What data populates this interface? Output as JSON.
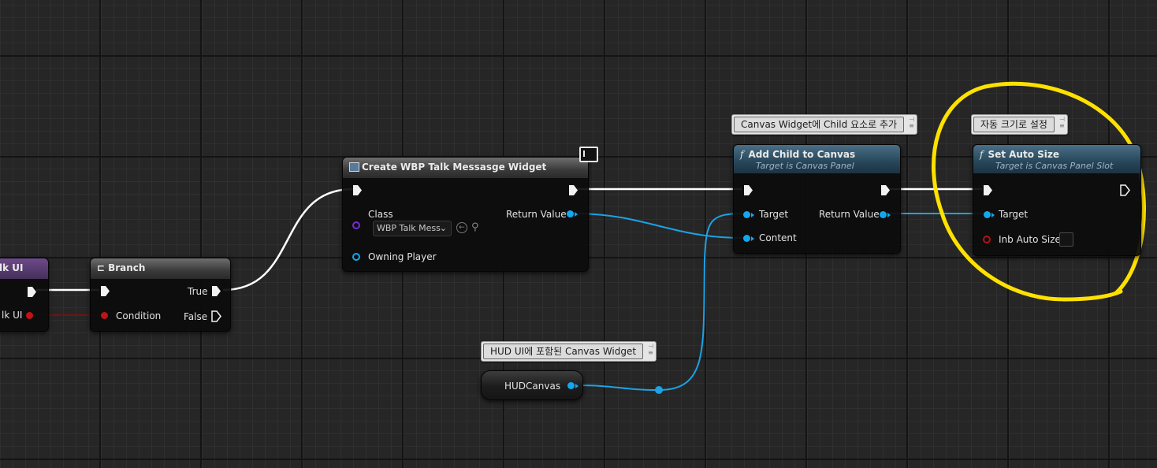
{
  "nodes": {
    "partial_event": {
      "title": "lk UI",
      "pin_label": "lk UI"
    },
    "branch": {
      "title": "Branch",
      "condition": "Condition",
      "true_label": "True",
      "false_label": "False"
    },
    "create_widget": {
      "title": "Create WBP Talk Messasge Widget",
      "class_label": "Class",
      "class_value": "WBP Talk Mess",
      "owning_player": "Owning Player",
      "return_value": "Return Value"
    },
    "add_child": {
      "title": "Add Child to Canvas",
      "subtitle": "Target is Canvas Panel",
      "target": "Target",
      "content": "Content",
      "return_value": "Return Value"
    },
    "set_auto_size": {
      "title": "Set Auto Size",
      "subtitle": "Target is Canvas Panel Slot",
      "target": "Target",
      "inb_auto_size": "Inb Auto Size",
      "inb_auto_size_checked": false
    },
    "hud_canvas": {
      "label": "HUDCanvas"
    }
  },
  "comments": {
    "add_child": "Canvas Widget에 Child 요소로 추가",
    "set_auto_size": "자동 크기로 설정",
    "hud_canvas": "HUD UI에 포함된 Canvas Widget"
  },
  "colors": {
    "exec_wire": "#ffffff",
    "object_wire": "#1ba3e6",
    "bool_wire": "#7a0f0f",
    "highlight": "#ffe100"
  }
}
